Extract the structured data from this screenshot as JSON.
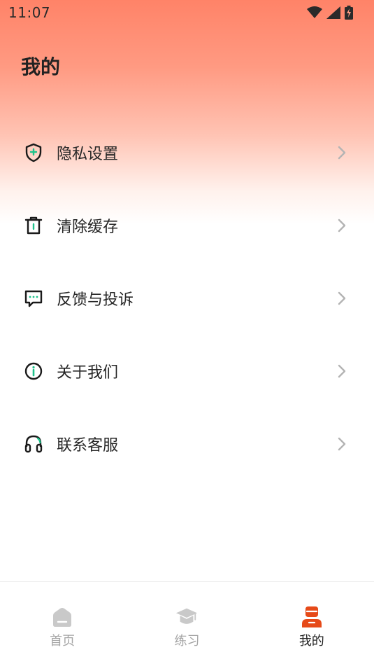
{
  "status_bar": {
    "time": "11:07"
  },
  "page": {
    "title": "我的"
  },
  "menu": {
    "items": [
      {
        "label": "隐私设置",
        "icon": "shield-plus-icon"
      },
      {
        "label": "清除缓存",
        "icon": "trash-icon"
      },
      {
        "label": "反馈与投诉",
        "icon": "chat-bubble-icon"
      },
      {
        "label": "关于我们",
        "icon": "info-icon"
      },
      {
        "label": "联系客服",
        "icon": "headphones-icon"
      }
    ]
  },
  "tabs": [
    {
      "label": "首页",
      "icon": "home-icon",
      "active": false
    },
    {
      "label": "练习",
      "icon": "graduation-cap-icon",
      "active": false
    },
    {
      "label": "我的",
      "icon": "user-icon",
      "active": true
    }
  ],
  "colors": {
    "accent": "#e64a19",
    "icon_accent": "#1ec28b",
    "tab_inactive": "#c9c9c9",
    "header_gradient_top": "#ff8368"
  }
}
